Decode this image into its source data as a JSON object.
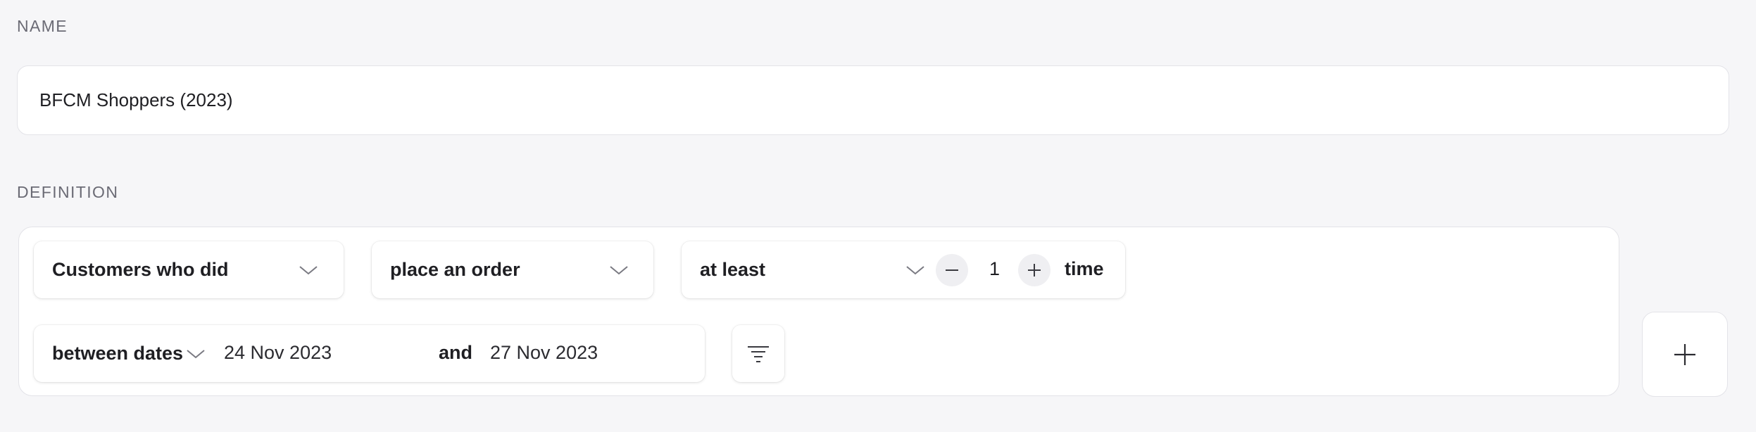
{
  "name_section": {
    "label": "NAME",
    "value": "BFCM Shoppers (2023)"
  },
  "definition_section": {
    "label": "DEFINITION",
    "subject_select": {
      "value": "Customers who did",
      "icon": "chevron-down-icon"
    },
    "action_select": {
      "value": "place an order",
      "icon": "chevron-down-icon"
    },
    "frequency": {
      "operator": "at least",
      "count": "1",
      "unit": "time",
      "decrement_icon": "minus-icon",
      "increment_icon": "plus-icon"
    },
    "timeframe": {
      "operator": "between dates",
      "start_date": "24 Nov 2023",
      "joiner": "and",
      "end_date": "27 Nov 2023"
    },
    "filter_button": {
      "icon": "filter-icon"
    },
    "add_condition_button": {
      "icon": "plus-icon"
    }
  },
  "colors": {
    "page_background": "#f6f6f8",
    "card_background": "#ffffff",
    "border": "#e3e3e8",
    "label_text": "#6b6b75",
    "primary_text": "#1f1f23"
  }
}
